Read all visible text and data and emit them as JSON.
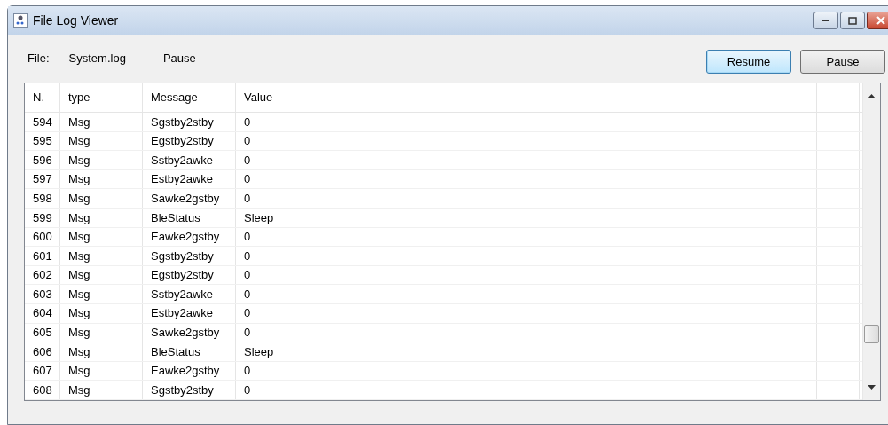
{
  "window": {
    "title": "File Log Viewer"
  },
  "info": {
    "file_label": "File:",
    "file_name": "System.log",
    "state": "Pause"
  },
  "buttons": [
    {
      "label": "Resume",
      "selected": true
    },
    {
      "label": "Pause",
      "selected": false
    }
  ],
  "table": {
    "columns": [
      "N.",
      "type",
      "Message",
      "Value"
    ],
    "rows": [
      [
        "594",
        "Msg",
        "Sgstby2stby",
        "0"
      ],
      [
        "595",
        "Msg",
        "Egstby2stby",
        "0"
      ],
      [
        "596",
        "Msg",
        "Sstby2awke",
        "0"
      ],
      [
        "597",
        "Msg",
        "Estby2awke",
        "0"
      ],
      [
        "598",
        "Msg",
        "Sawke2gstby",
        "0"
      ],
      [
        "599",
        "Msg",
        "BleStatus",
        "Sleep"
      ],
      [
        "600",
        "Msg",
        "Eawke2gstby",
        "0"
      ],
      [
        "601",
        "Msg",
        "Sgstby2stby",
        "0"
      ],
      [
        "602",
        "Msg",
        "Egstby2stby",
        "0"
      ],
      [
        "603",
        "Msg",
        "Sstby2awke",
        "0"
      ],
      [
        "604",
        "Msg",
        "Estby2awke",
        "0"
      ],
      [
        "605",
        "Msg",
        "Sawke2gstby",
        "0"
      ],
      [
        "606",
        "Msg",
        "BleStatus",
        "Sleep"
      ],
      [
        "607",
        "Msg",
        "Eawke2gstby",
        "0"
      ],
      [
        "608",
        "Msg",
        "Sgstby2stby",
        "0"
      ]
    ]
  }
}
